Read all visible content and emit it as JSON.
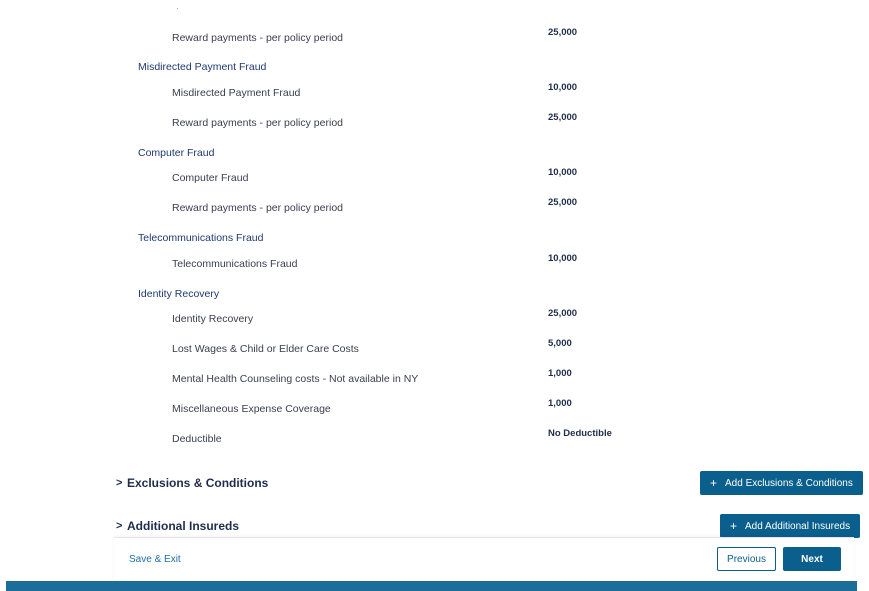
{
  "coverages": {
    "top_reward": {
      "label": "Reward payments - per policy period",
      "value": "25,000"
    },
    "misdirected": {
      "title": "Misdirected Payment Fraud",
      "rows": [
        {
          "label": "Misdirected Payment Fraud",
          "value": "10,000"
        },
        {
          "label": "Reward payments - per policy period",
          "value": "25,000"
        }
      ]
    },
    "computer": {
      "title": "Computer Fraud",
      "rows": [
        {
          "label": "Computer Fraud",
          "value": "10,000"
        },
        {
          "label": "Reward payments - per policy period",
          "value": "25,000"
        }
      ]
    },
    "telecom": {
      "title": "Telecommunications Fraud",
      "rows": [
        {
          "label": "Telecommunications Fraud",
          "value": "10,000"
        }
      ]
    },
    "identity": {
      "title": "Identity Recovery",
      "rows": [
        {
          "label": "Identity Recovery",
          "value": "25,000"
        },
        {
          "label": "Lost Wages & Child or Elder Care Costs",
          "value": "5,000"
        },
        {
          "label": "Mental Health Counseling costs - Not available in NY",
          "value": "1,000"
        },
        {
          "label": "Miscellaneous Expense Coverage",
          "value": "1,000"
        },
        {
          "label": "Deductible",
          "value": "No Deductible"
        }
      ]
    }
  },
  "sections": {
    "exclusions": {
      "chevron": ">",
      "title": "Exclusions & Conditions",
      "add_label": "Add Exclusions & Conditions"
    },
    "insureds": {
      "chevron": ">",
      "title": "Additional Insureds",
      "add_label": "Add Additional Insureds"
    }
  },
  "footer": {
    "save_exit": "Save & Exit",
    "previous": "Previous",
    "next": "Next"
  },
  "icons": {
    "plus": "+"
  },
  "colors": {
    "primary": "#0a5f8c",
    "bottom_bar": "#1a6e98",
    "link": "#1b6fa8"
  }
}
